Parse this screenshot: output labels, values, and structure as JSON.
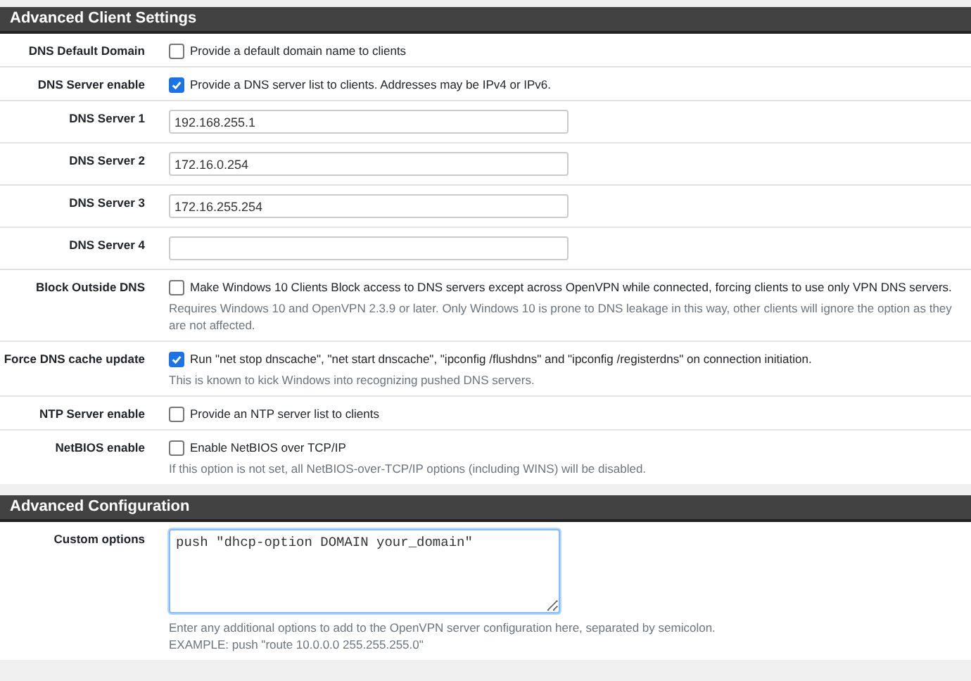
{
  "sections": [
    {
      "title": "Advanced Client Settings",
      "rows": [
        {
          "label": "DNS Default Domain",
          "kind": "checkbox",
          "checked": false,
          "text": "Provide a default domain name to clients"
        },
        {
          "label": "DNS Server enable",
          "kind": "checkbox",
          "checked": true,
          "text": "Provide a DNS server list to clients. Addresses may be IPv4 or IPv6."
        },
        {
          "label": "DNS Server 1",
          "kind": "input",
          "value": "192.168.255.1"
        },
        {
          "label": "DNS Server 2",
          "kind": "input",
          "value": "172.16.0.254"
        },
        {
          "label": "DNS Server 3",
          "kind": "input",
          "value": "172.16.255.254"
        },
        {
          "label": "DNS Server 4",
          "kind": "input"
        },
        {
          "label": "Block Outside DNS",
          "kind": "checkbox",
          "checked": false,
          "text": "Make Windows 10 Clients Block access to DNS servers except across OpenVPN while connected, forcing clients to use only VPN DNS servers.",
          "help": [
            "Requires Windows 10 and OpenVPN 2.3.9 or later. Only Windows 10 is prone to DNS leakage in this way, other clients will ignore the option as they are not affected."
          ]
        },
        {
          "label": "Force DNS cache update",
          "kind": "checkbox",
          "checked": true,
          "text": "Run \"net stop dnscache\", \"net start dnscache\", \"ipconfig /flushdns\" and \"ipconfig /registerdns\" on connection initiation.",
          "help": [
            "This is known to kick Windows into recognizing pushed DNS servers."
          ]
        },
        {
          "label": "NTP Server enable",
          "kind": "checkbox",
          "checked": false,
          "text": "Provide an NTP server list to clients"
        },
        {
          "label": "NetBIOS enable",
          "kind": "checkbox",
          "checked": false,
          "text": "Enable NetBIOS over TCP/IP",
          "help": [
            "If this option is not set, all NetBIOS-over-TCP/IP options (including WINS) will be disabled."
          ]
        }
      ]
    },
    {
      "title": "Advanced Configuration",
      "rows": [
        {
          "label": "Custom options",
          "kind": "textarea",
          "value": "push \"dhcp-option DOMAIN your_domain\"",
          "help": [
            "Enter any additional options to add to the OpenVPN server configuration here, separated by semicolon.",
            "EXAMPLE: push \"route 10.0.0.0 255.255.255.0\""
          ]
        }
      ]
    }
  ]
}
